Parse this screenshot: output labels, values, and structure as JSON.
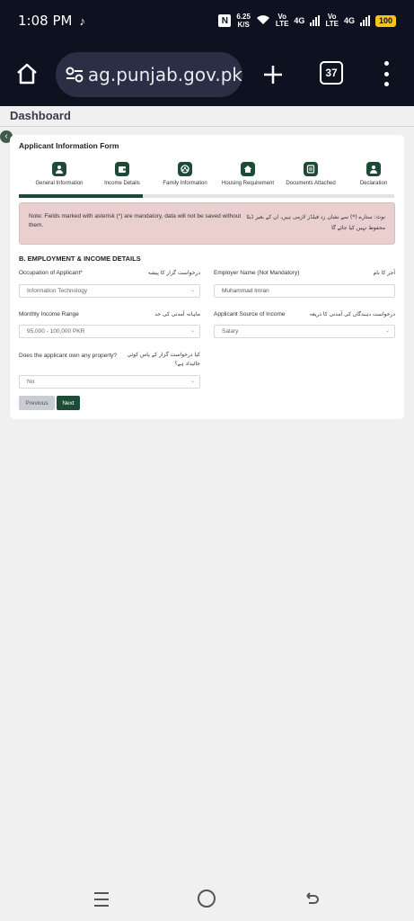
{
  "status_bar": {
    "time": "1:08 PM",
    "note_icon": "music-note-icon",
    "speed_value": "6.25",
    "speed_unit": "K/S",
    "net1_top": "Vo",
    "net1_bottom": "LTE",
    "net1_gen": "4G",
    "net2_top": "Vo",
    "net2_bottom": "LTE",
    "net2_gen": "4G",
    "battery": "100",
    "battery_color": "#f5c518"
  },
  "browser": {
    "url": "ag.punjab.gov.pk",
    "tab_count": "37"
  },
  "page": {
    "title": "Dashboard"
  },
  "form": {
    "title": "Applicant Information Form",
    "steps": [
      {
        "label": "General Information",
        "icon": "person-icon"
      },
      {
        "label": "Income Details",
        "icon": "wallet-icon"
      },
      {
        "label": "Family Information",
        "icon": "family-icon"
      },
      {
        "label": "Housing Requirement",
        "icon": "house-icon"
      },
      {
        "label": "Documents Attached",
        "icon": "document-icon"
      },
      {
        "label": "Declaration",
        "icon": "person-icon"
      }
    ],
    "progress_fraction": 0.33,
    "accent_color": "#1e4b36",
    "note_en": "Note: Fields marked with asterisk (*) are mandatory, data will not be saved without them.",
    "note_ur": "نوٹ: ستارے (*) سے نشان زد فیلڈز لازمی ہیں، ان کے بغیر ڈیٹا محفوظ نہیں کیا جائے گا",
    "section_title": "B. EMPLOYMENT & INCOME DETAILS",
    "fields": {
      "occupation": {
        "label": "Occupation of Applicant*",
        "label_ur": "درخواست گزار کا پیشہ",
        "value": "Information Technology"
      },
      "employer": {
        "label": "Employer Name (Not Mandatory)",
        "label_ur": "آجر کا نام",
        "value": "Muhammad Imran"
      },
      "income_range": {
        "label": "Monthly Income Range",
        "label_ur": "ماہانہ آمدنی کی حد",
        "value": "95,000 - 100,000 PKR"
      },
      "income_source": {
        "label": "Applicant Source of Income",
        "label_ur": "درخواست دہندگان کی آمدنی کا ذریعہ",
        "value": "Salary"
      },
      "property": {
        "label": "Does the applicant own any property?",
        "label_ur": "کیا درخواست گزار کے پاس کوئی جائیداد ہے؟",
        "value": "No"
      }
    },
    "buttons": {
      "previous": "Previous",
      "next": "Next"
    }
  }
}
